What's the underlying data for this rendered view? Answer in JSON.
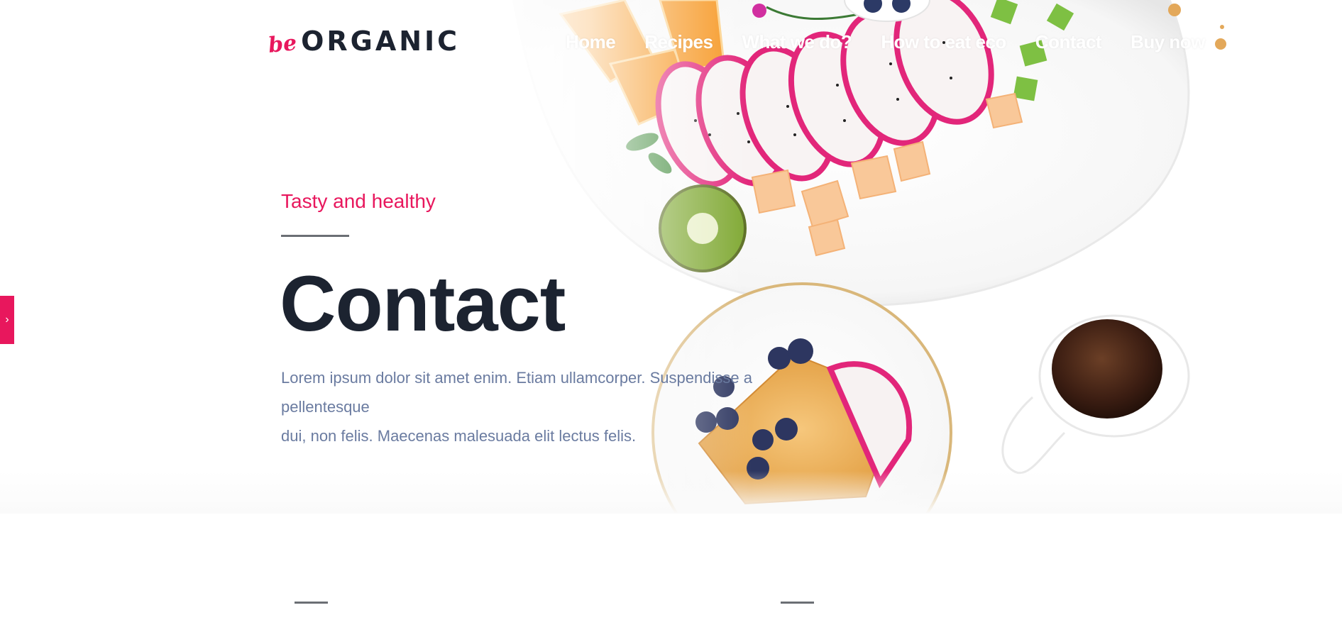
{
  "header": {
    "logo": {
      "prefix": "be",
      "name": "ORGANIC"
    },
    "nav": [
      {
        "label": "Home"
      },
      {
        "label": "Recipes"
      },
      {
        "label": "What we do?"
      },
      {
        "label": "How to eat eco"
      },
      {
        "label": "Contact"
      },
      {
        "label": "Buy now"
      }
    ]
  },
  "side_tab": {
    "icon": "chevron-right-icon",
    "glyph": "›"
  },
  "hero": {
    "eyebrow": "Tasty and healthy",
    "title": "Contact",
    "lead_lines": [
      "Lorem ipsum dolor sit amet enim. Etiam ullamcorper. Suspendisse a pellentesque",
      "dui, non felis. Maecenas malesuada elit lectus felis."
    ]
  },
  "colors": {
    "accent": "#e8175d",
    "heading": "#1c2330",
    "body_text": "#6a7ba0",
    "divider": "#6b6f74"
  }
}
